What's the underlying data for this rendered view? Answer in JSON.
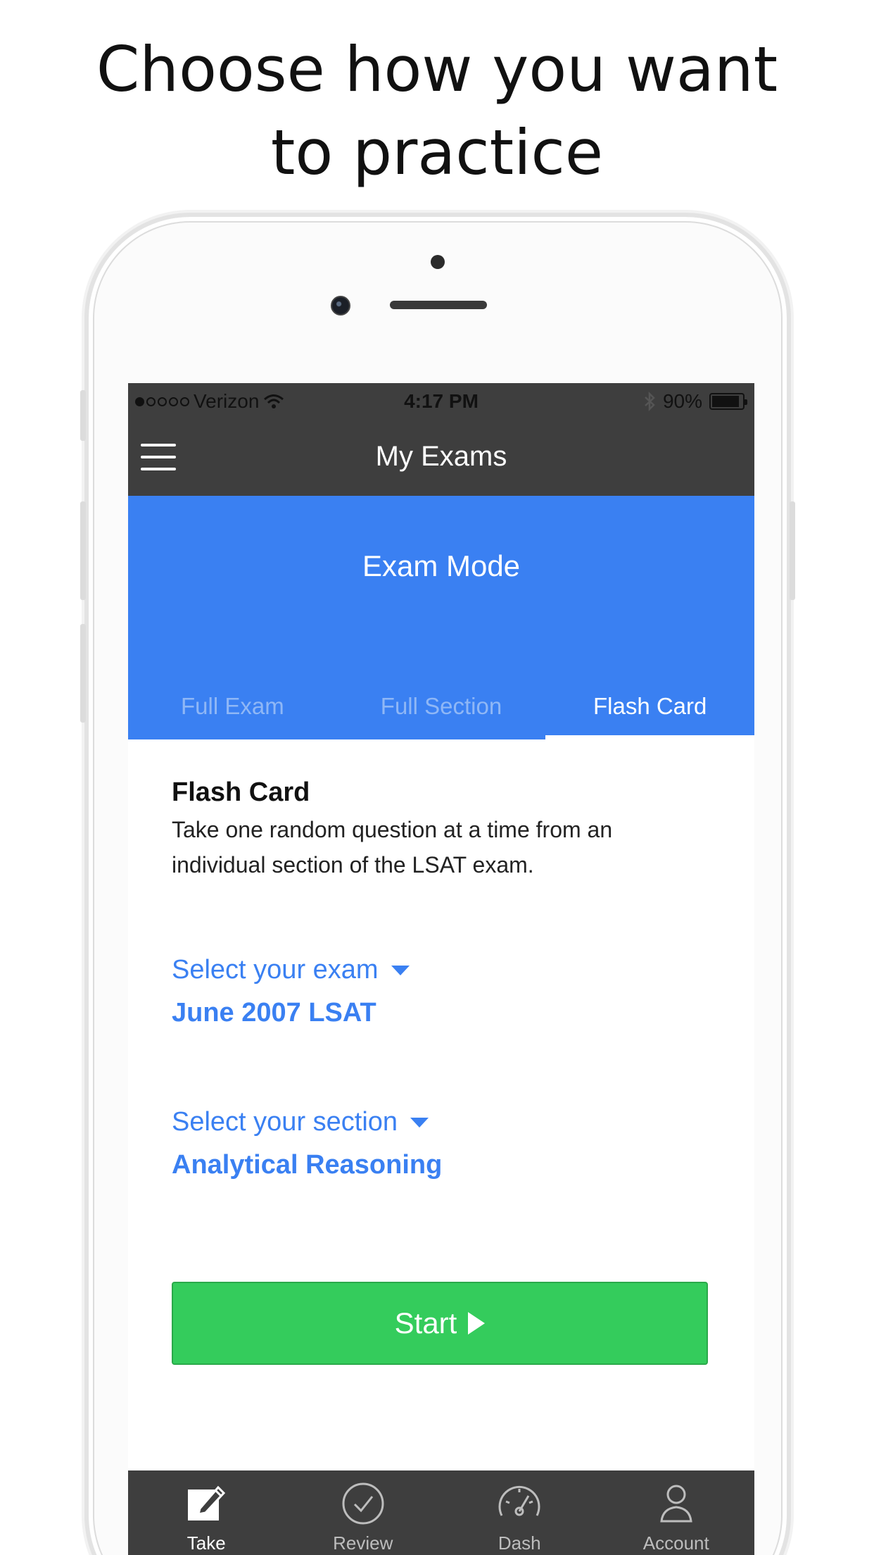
{
  "headline": {
    "line1": "Choose how you want",
    "line2": "to practice"
  },
  "status_bar": {
    "carrier": "Verizon",
    "time": "4:17 PM",
    "battery": "90%",
    "battery_level": 0.9
  },
  "nav": {
    "title": "My Exams",
    "menu_icon": "hamburger-icon"
  },
  "mode": {
    "title": "Exam Mode",
    "tabs": [
      {
        "label": "Full Exam",
        "active": false
      },
      {
        "label": "Full Section",
        "active": false
      },
      {
        "label": "Flash Card",
        "active": true
      }
    ]
  },
  "description": {
    "title": "Flash Card",
    "text_line1": "Take one random question at a time from an",
    "text_line2": "individual section of the LSAT exam."
  },
  "exam_select": {
    "label": "Select your exam",
    "value": "June 2007 LSAT"
  },
  "section_select": {
    "label": "Select your section",
    "value": "Analytical Reasoning"
  },
  "start_button": {
    "label": "Start"
  },
  "tab_bar": [
    {
      "label": "Take",
      "icon": "edit-icon",
      "active": true
    },
    {
      "label": "Review",
      "icon": "check-circle-icon",
      "active": false
    },
    {
      "label": "Dash",
      "icon": "speedometer-icon",
      "active": false
    },
    {
      "label": "Account",
      "icon": "person-icon",
      "active": false
    }
  ],
  "colors": {
    "accent": "#3a80f2",
    "start_green": "#34cc5c",
    "bar_dark": "#3e3e3e"
  }
}
